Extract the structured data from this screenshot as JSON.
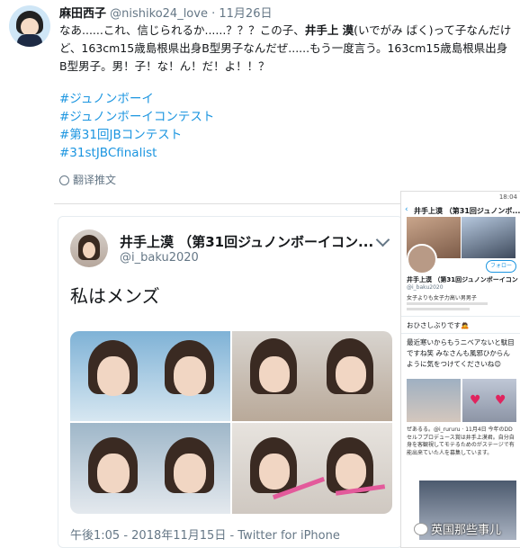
{
  "tweet": {
    "name": "麻田西子",
    "handle": "@nishiko24_love",
    "separator": "·",
    "date": "11月26日",
    "text_prefix": "なあ......これ、信じられるか......？？？この子、",
    "text_bold": "井手上 漠",
    "text_suffix": "(いでがみ ばく)って子なんだけど、163cm15歳島根県出身B型男子なんだぜ......もう一度言う。163cm15歳島根県出身B型男子。男！子！な！ん！だ！よ！！？",
    "hashtags": [
      "#ジュノンボーイ",
      "#ジュノンボーイコンテスト",
      "#第31回JBコンテスト",
      "#31stJBCfinalist"
    ],
    "translate_label": "翻译推文"
  },
  "embedded": {
    "name": "井手上漠 （第31回ジュノンボーイコン...",
    "handle": "@i_baku2020",
    "text": "私はメンズ",
    "footer": "午後1:05 - 2018年11月15日 - Twitter for iPhone"
  },
  "phone": {
    "status": "18:04",
    "title": "井手上漠 （第31回ジュノンボ...",
    "follow": "フォロー",
    "name": "井手上漠 （第31回ジュノンボーイコン",
    "handle": "@i_baku2020",
    "bio": "女子よりも女子力高い男男子",
    "tweet1": "おひさしぶりです🙇",
    "tweet2": "最近寒いからもうニベアないと駄目ですね笑 みなさんも風邪ひからんように気をつけてくださいね😊",
    "tweet3": "ぜあるる。@i_rururu · 11月4日 今年のDDセルフプロデュース賞は井手上漠君。自分自身を客観視してモテるためのがステージで有能出来ていた人を募集しています。"
  },
  "watermark": "英国那些事儿"
}
